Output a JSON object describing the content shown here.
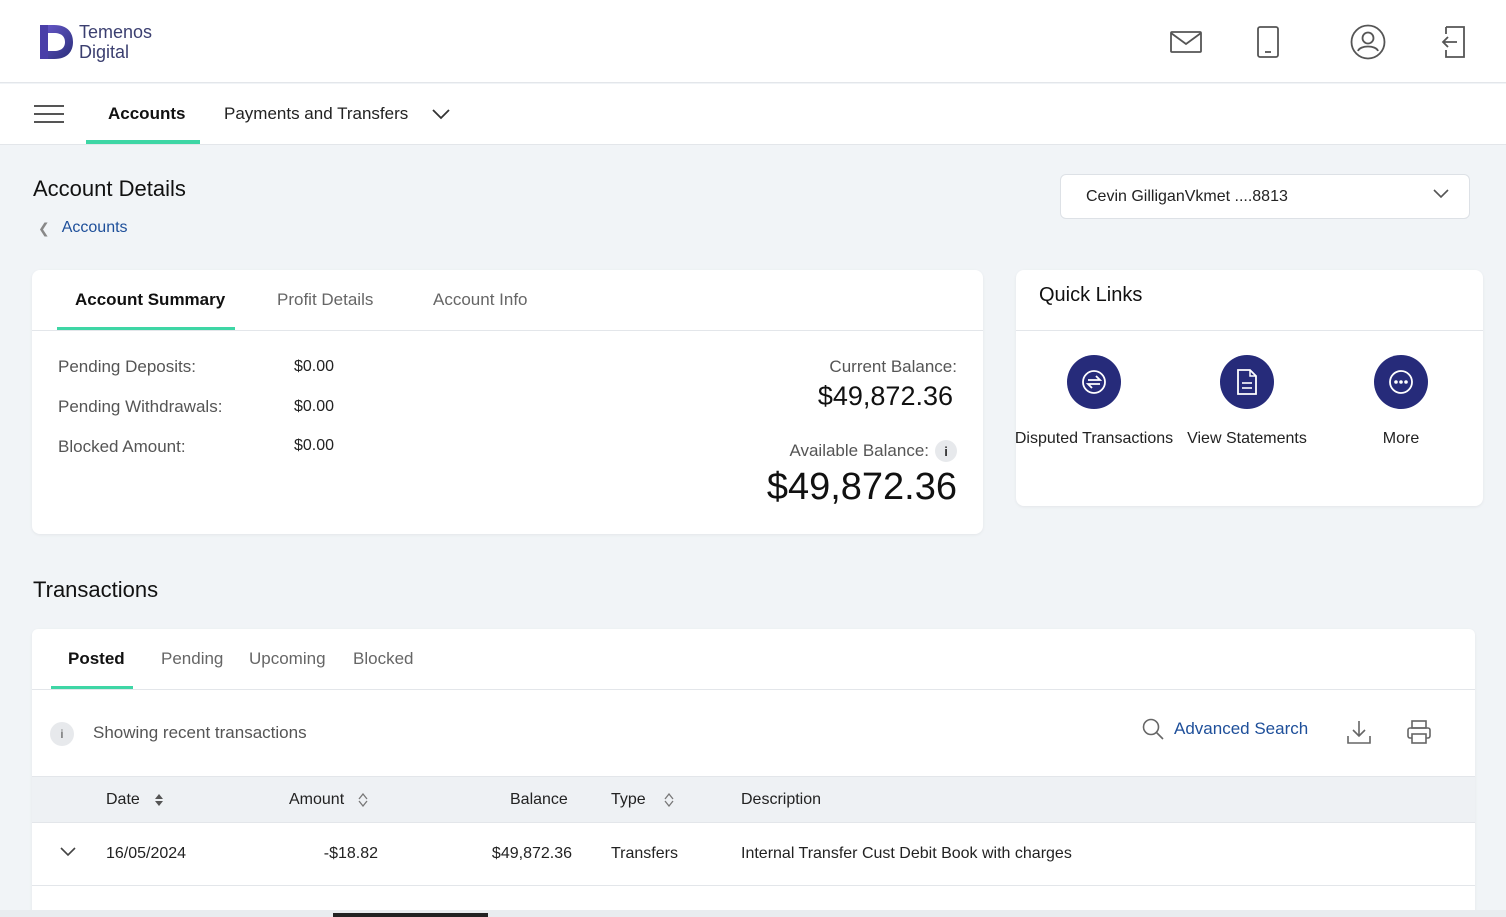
{
  "brand": {
    "line1": "Temenos",
    "line2": "Digital"
  },
  "header_icons": [
    "mail-icon",
    "mobile-icon",
    "user-profile-icon",
    "logout-icon"
  ],
  "nav": {
    "tabs": [
      {
        "label": "Accounts",
        "active": true
      },
      {
        "label": "Payments and Transfers",
        "active": false
      }
    ]
  },
  "page": {
    "title": "Account Details",
    "breadcrumb": "Accounts",
    "account_selector": "Cevin GilliganVkmet ....8813"
  },
  "summary": {
    "tabs": [
      "Account Summary",
      "Profit Details",
      "Account Info"
    ],
    "active_tab": "Account Summary",
    "items": [
      {
        "label": "Pending Deposits:",
        "value": "$0.00"
      },
      {
        "label": "Pending Withdrawals:",
        "value": "$0.00"
      },
      {
        "label": "Blocked Amount:",
        "value": "$0.00"
      }
    ],
    "current_balance_label": "Current Balance:",
    "current_balance": "$49,872.36",
    "available_balance_label": "Available Balance:",
    "available_balance": "$49,872.36",
    "info_glyph": "i"
  },
  "quick_links": {
    "title": "Quick Links",
    "items": [
      {
        "label": "Disputed Transactions",
        "icon": "dispute-icon"
      },
      {
        "label": "View Statements",
        "icon": "document-icon"
      },
      {
        "label": "More",
        "icon": "more-icon"
      }
    ]
  },
  "transactions": {
    "title": "Transactions",
    "tabs": [
      "Posted",
      "Pending",
      "Upcoming",
      "Blocked"
    ],
    "active_tab": "Posted",
    "info_text": "Showing recent transactions",
    "info_glyph": "i",
    "advanced_search": "Advanced Search",
    "columns": [
      "Date",
      "Amount",
      "Balance",
      "Type",
      "Description"
    ],
    "rows": [
      {
        "date": "16/05/2024",
        "amount": "-$18.82",
        "balance": "$49,872.36",
        "type": "Transfers",
        "description": "Internal Transfer Cust Debit Book with charges"
      }
    ]
  },
  "colors": {
    "accent": "#3ed6a5",
    "brand_navy": "#262b7a",
    "link": "#1e4f9a"
  }
}
